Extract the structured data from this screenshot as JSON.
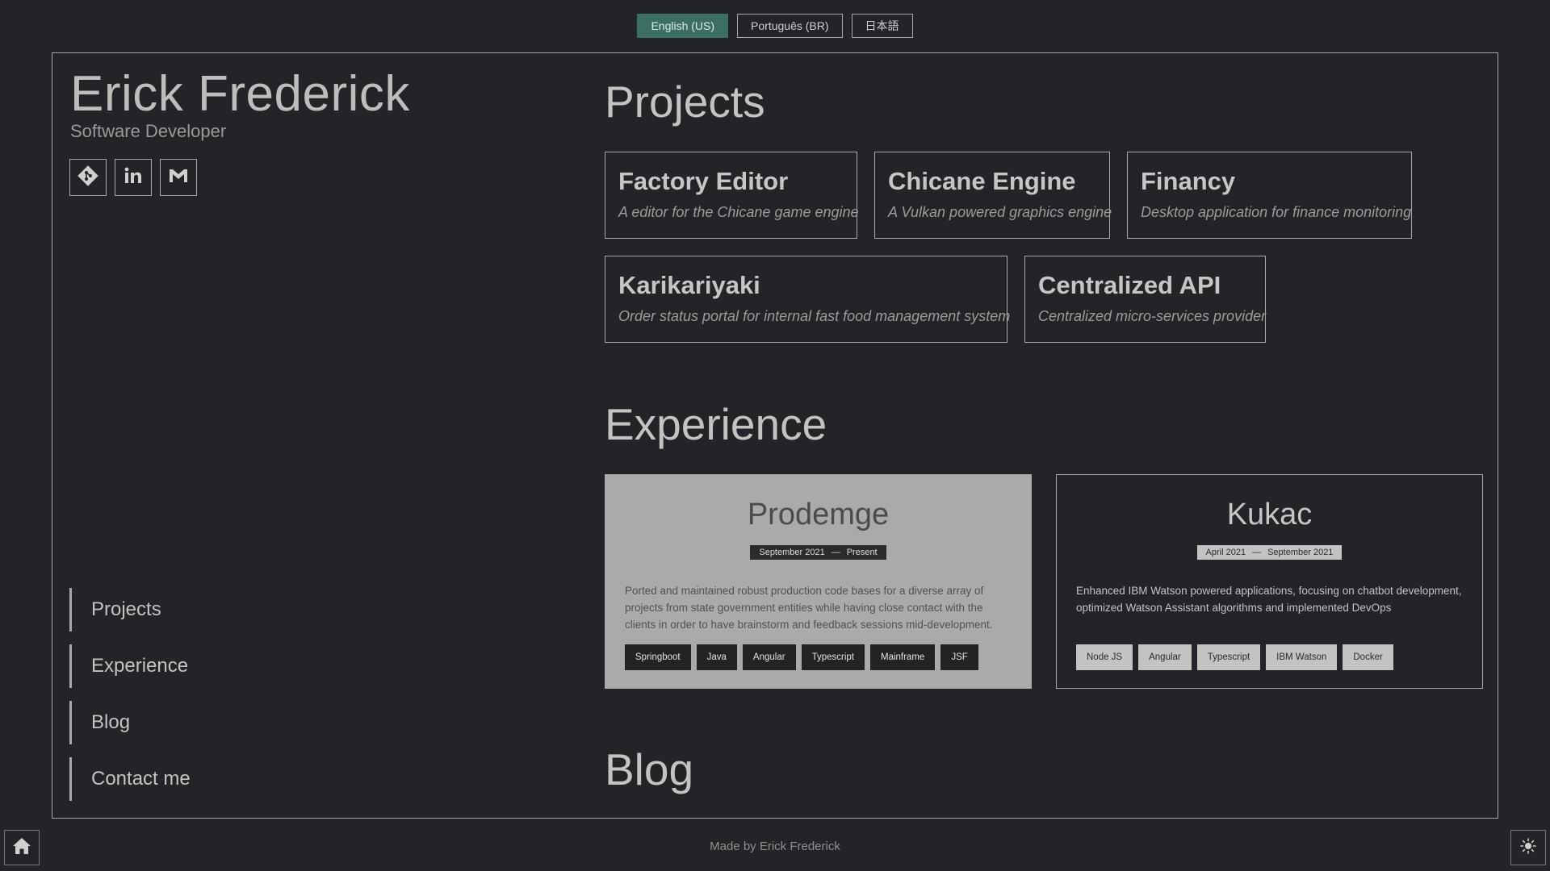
{
  "languages": [
    {
      "label": "English (US)",
      "active": true
    },
    {
      "label": "Português (BR)",
      "active": false
    },
    {
      "label": "日本語",
      "active": false
    }
  ],
  "profile": {
    "name": "Erick Frederick",
    "role": "Software Developer",
    "socials": [
      "git-icon",
      "linkedin-icon",
      "gmail-icon"
    ]
  },
  "nav": {
    "items": [
      "Projects",
      "Experience",
      "Blog",
      "Contact me"
    ]
  },
  "sections": {
    "projects_title": "Projects",
    "experience_title": "Experience",
    "blog_title": "Blog"
  },
  "projects": [
    {
      "title": "Factory Editor",
      "desc": "A editor for the Chicane game engine"
    },
    {
      "title": "Chicane Engine",
      "desc": "A Vulkan powered graphics engine"
    },
    {
      "title": "Financy",
      "desc": "Desktop application for finance monitoring"
    },
    {
      "title": "Karikariyaki",
      "desc": "Order status portal for internal fast food management system"
    },
    {
      "title": "Centralized API",
      "desc": "Centralized micro-services provider"
    }
  ],
  "experience": [
    {
      "company": "Prodemge",
      "start": "September 2021",
      "sep": "—",
      "end": "Present",
      "desc": "Ported and maintained robust production code bases for a diverse array of projects from state government entities while having close contact with the clients in order to have brainstorm and feedback sessions mid-development.",
      "tags": [
        "Springboot",
        "Java",
        "Angular",
        "Typescript",
        "Mainframe",
        "JSF"
      ]
    },
    {
      "company": "Kukac",
      "start": "April 2021",
      "sep": "—",
      "end": "September 2021",
      "desc": "Enhanced IBM Watson powered applications, focusing on chatbot development, optimized Watson Assistant algorithms and implemented DevOps",
      "tags": [
        "Node JS",
        "Angular",
        "Typescript",
        "IBM Watson",
        "Docker"
      ]
    }
  ],
  "footer": {
    "text": "Made by Erick Frederick",
    "home_icon": "home-icon",
    "theme_icon": "sun-icon"
  }
}
